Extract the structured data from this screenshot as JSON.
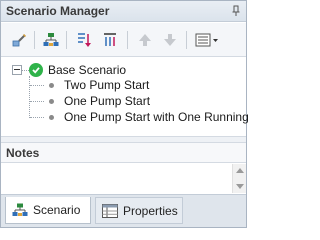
{
  "window": {
    "title": "Scenario Manager",
    "pin_icon": "pin-icon"
  },
  "toolbar": {
    "buttons": [
      {
        "name": "rename-scenario-button",
        "icon": "edit-icon"
      },
      {
        "name": "create-child-button",
        "icon": "tree-add-icon"
      },
      {
        "name": "sort-down-button",
        "icon": "sort-down-icon"
      },
      {
        "name": "sort-up-button",
        "icon": "sort-up-icon"
      },
      {
        "name": "move-up-button",
        "icon": "arrow-up-icon"
      },
      {
        "name": "move-down-button",
        "icon": "arrow-down-icon"
      },
      {
        "name": "view-options-button",
        "icon": "list-dropdown-icon"
      }
    ]
  },
  "tree": {
    "root": {
      "label": "Base Scenario",
      "status": "current",
      "icon": "check-icon"
    },
    "children": [
      {
        "label": "Two Pump Start"
      },
      {
        "label": "One Pump Start"
      },
      {
        "label": "One Pump Start with One Running"
      }
    ]
  },
  "notes": {
    "header": "Notes",
    "text": ""
  },
  "tabs": [
    {
      "label": "Scenario",
      "active": true,
      "icon": "scenario-tree-icon"
    },
    {
      "label": "Properties",
      "active": false,
      "icon": "properties-table-icon"
    }
  ],
  "colors": {
    "accent_check": "#2fb34a",
    "tree_icon_green": "#2c8a3e",
    "tree_icon_blue": "#2f6fb7"
  }
}
